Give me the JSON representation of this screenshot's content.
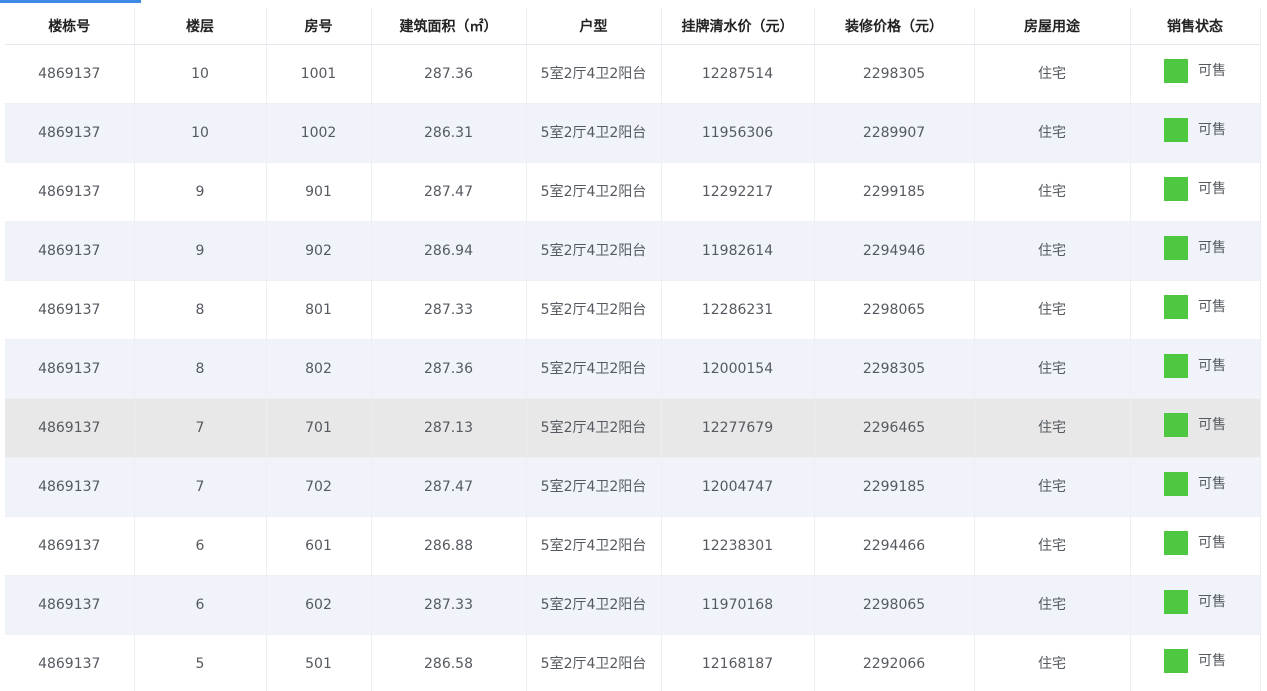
{
  "table": {
    "headers": [
      "楼栋号",
      "楼层",
      "房号",
      "建筑面积（㎡）",
      "户型",
      "挂牌清水价（元）",
      "装修价格（元）",
      "房屋用途",
      "销售状态"
    ],
    "rows": [
      {
        "building": "4869137",
        "floor": "10",
        "room": "1001",
        "area": "287.36",
        "layout": "5室2厅4卫2阳台",
        "listed_price": "12287514",
        "decoration_price": "2298305",
        "usage": "住宅",
        "status": "可售"
      },
      {
        "building": "4869137",
        "floor": "10",
        "room": "1002",
        "area": "286.31",
        "layout": "5室2厅4卫2阳台",
        "listed_price": "11956306",
        "decoration_price": "2289907",
        "usage": "住宅",
        "status": "可售"
      },
      {
        "building": "4869137",
        "floor": "9",
        "room": "901",
        "area": "287.47",
        "layout": "5室2厅4卫2阳台",
        "listed_price": "12292217",
        "decoration_price": "2299185",
        "usage": "住宅",
        "status": "可售"
      },
      {
        "building": "4869137",
        "floor": "9",
        "room": "902",
        "area": "286.94",
        "layout": "5室2厅4卫2阳台",
        "listed_price": "11982614",
        "decoration_price": "2294946",
        "usage": "住宅",
        "status": "可售"
      },
      {
        "building": "4869137",
        "floor": "8",
        "room": "801",
        "area": "287.33",
        "layout": "5室2厅4卫2阳台",
        "listed_price": "12286231",
        "decoration_price": "2298065",
        "usage": "住宅",
        "status": "可售"
      },
      {
        "building": "4869137",
        "floor": "8",
        "room": "802",
        "area": "287.36",
        "layout": "5室2厅4卫2阳台",
        "listed_price": "12000154",
        "decoration_price": "2298305",
        "usage": "住宅",
        "status": "可售"
      },
      {
        "building": "4869137",
        "floor": "7",
        "room": "701",
        "area": "287.13",
        "layout": "5室2厅4卫2阳台",
        "listed_price": "12277679",
        "decoration_price": "2296465",
        "usage": "住宅",
        "status": "可售"
      },
      {
        "building": "4869137",
        "floor": "7",
        "room": "702",
        "area": "287.47",
        "layout": "5室2厅4卫2阳台",
        "listed_price": "12004747",
        "decoration_price": "2299185",
        "usage": "住宅",
        "status": "可售"
      },
      {
        "building": "4869137",
        "floor": "6",
        "room": "601",
        "area": "286.88",
        "layout": "5室2厅4卫2阳台",
        "listed_price": "12238301",
        "decoration_price": "2294466",
        "usage": "住宅",
        "status": "可售"
      },
      {
        "building": "4869137",
        "floor": "6",
        "room": "602",
        "area": "287.33",
        "layout": "5室2厅4卫2阳台",
        "listed_price": "11970168",
        "decoration_price": "2298065",
        "usage": "住宅",
        "status": "可售"
      },
      {
        "building": "4869137",
        "floor": "5",
        "room": "501",
        "area": "286.58",
        "layout": "5室2厅4卫2阳台",
        "listed_price": "12168187",
        "decoration_price": "2292066",
        "usage": "住宅",
        "status": "可售"
      }
    ]
  },
  "colors": {
    "status_available": "#4ec741",
    "row_stripe": "#f0f3fa",
    "row_hover": "#e8e8e8",
    "accent": "#3f8ae8"
  },
  "hovered_row": 6
}
